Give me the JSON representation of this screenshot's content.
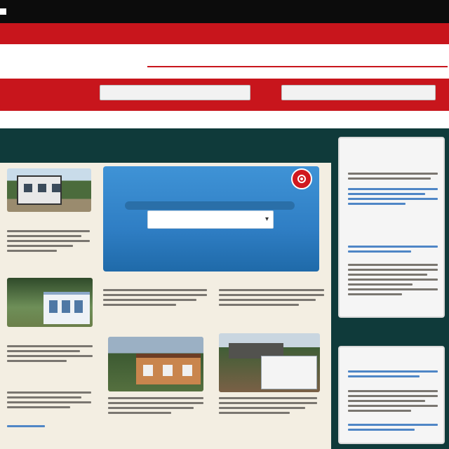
{
  "topbar": {
    "links": [
      "",
      "",
      ""
    ]
  },
  "header": {
    "tagline": "",
    "logo_text": "",
    "slogan": "",
    "nav_label": "",
    "nav_fields": [
      "",
      ""
    ],
    "sub_links": [
      "",
      ""
    ]
  },
  "main": {
    "heading": "",
    "promo": {
      "search_value": ""
    },
    "sections": [
      {
        "title": "",
        "caption": ""
      },
      {
        "title": "",
        "caption": ""
      },
      {
        "title": "",
        "caption": ""
      },
      {
        "title": "",
        "caption": ""
      }
    ],
    "left_column": {
      "title_1": "",
      "title_2": "",
      "title_3": ""
    },
    "image_captions": [
      "",
      ""
    ]
  },
  "sidebar": {
    "card_1": {
      "heading": "",
      "subheading": "",
      "red_heading": ""
    },
    "rail_heading": "",
    "card_2": {
      "heading": ""
    }
  },
  "colors": {
    "brand_red": "#c8151c",
    "teal": "#0f3a3a",
    "panel": "#f3eee2",
    "promo_blue": "#2f7ec4",
    "link_blue": "#1a5fb4"
  },
  "icons": {
    "promo_badge": "chat-bubble-icon",
    "search_chevron": "chevron-down-icon",
    "top_logo": "square-logo-icon"
  }
}
